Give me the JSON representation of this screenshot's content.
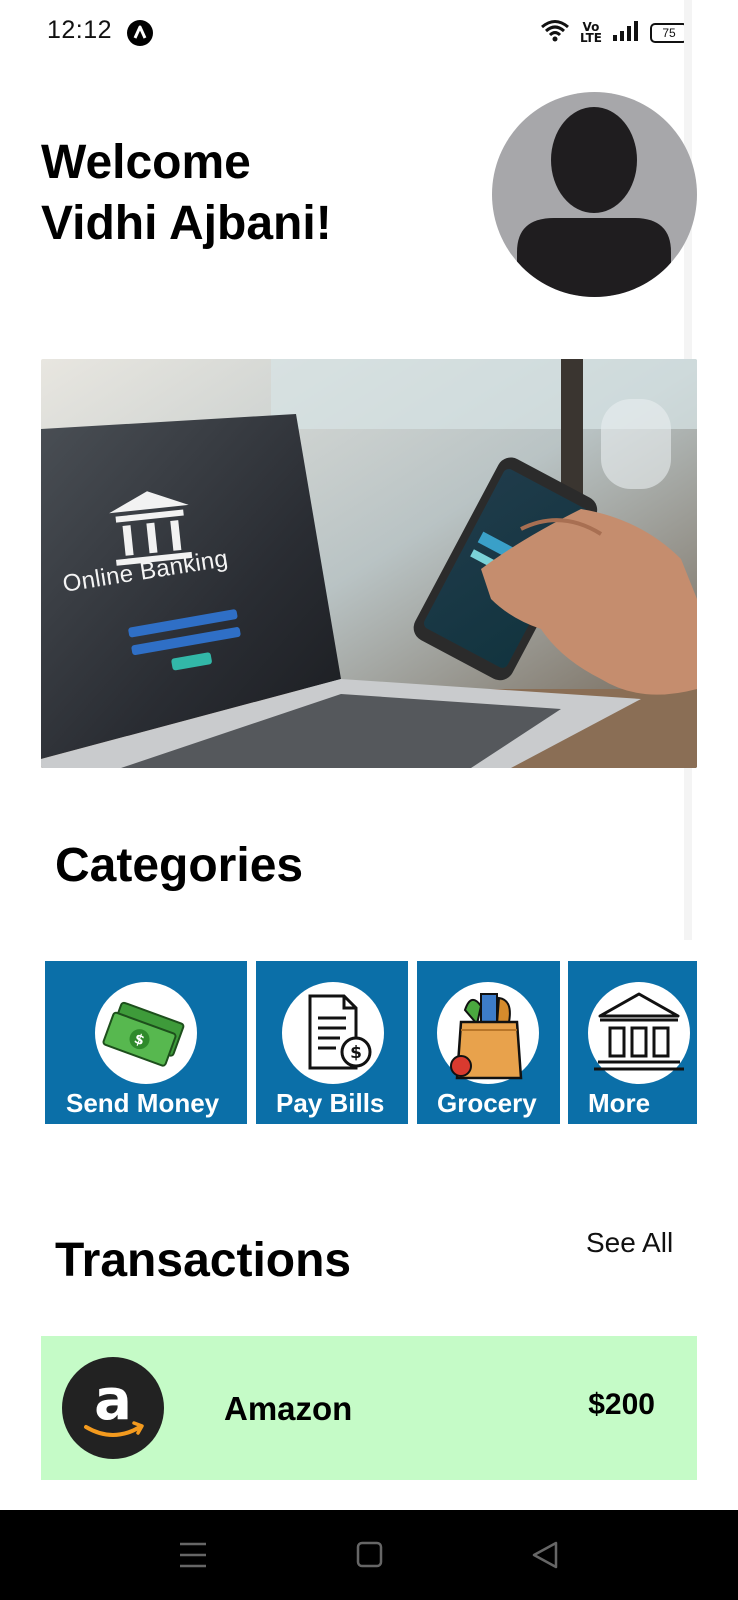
{
  "status_bar": {
    "time": "12:12",
    "network_label": "Vo\nLTE",
    "battery": "75"
  },
  "welcome": {
    "line1": "Welcome",
    "line2": "Vidhi Ajbani!"
  },
  "banner": {
    "text": "Online Banking"
  },
  "categories": {
    "title": "Categories",
    "items": [
      {
        "label": "Send Money",
        "icon": "money-icon"
      },
      {
        "label": "Pay Bills",
        "icon": "bill-icon"
      },
      {
        "label": "Grocery",
        "icon": "grocery-bag-icon"
      },
      {
        "label": "More",
        "icon": "bank-icon"
      }
    ]
  },
  "transactions": {
    "title": "Transactions",
    "see_all": "See All",
    "items": [
      {
        "name": "Amazon",
        "amount": "$200",
        "icon": "amazon-logo"
      }
    ]
  },
  "colors": {
    "category_card": "#0b6fa8",
    "transaction_bg": "#c5fbc7",
    "avatar_bg": "#a7a7aa"
  }
}
